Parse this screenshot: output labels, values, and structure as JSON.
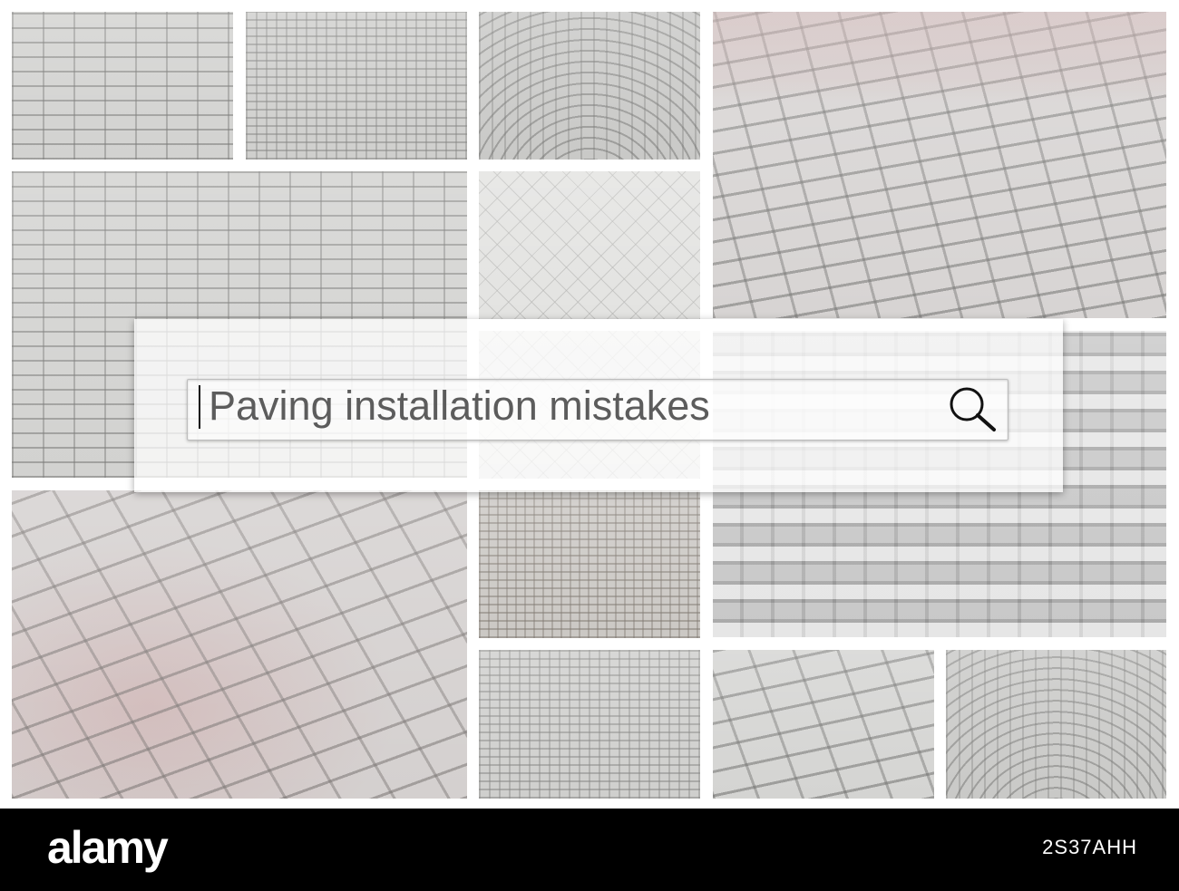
{
  "search": {
    "query": "Paving installation mistakes",
    "icon": "magnifier"
  },
  "footer": {
    "logo": "alamy",
    "image_id": "2S37AHH"
  },
  "colors": {
    "footer_background": "#000000",
    "search_text": "#5c5c5c",
    "paving_gray": "#d2d2d0",
    "paving_pink": "#cdaaaa"
  }
}
